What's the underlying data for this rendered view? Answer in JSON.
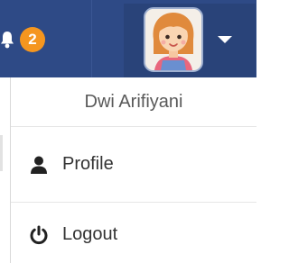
{
  "header": {
    "notifications": {
      "icon": "bell-icon",
      "count": "2",
      "badge_color": "#f5961f"
    },
    "user_menu": {
      "avatar": "user-avatar",
      "toggle_icon": "caret-down-icon"
    },
    "bar_color": "#2e4a86"
  },
  "dropdown": {
    "user_name": "Dwi Arifiyani",
    "items": [
      {
        "label": "Profile",
        "icon": "user-icon"
      },
      {
        "label": "Logout",
        "icon": "power-icon"
      }
    ]
  }
}
